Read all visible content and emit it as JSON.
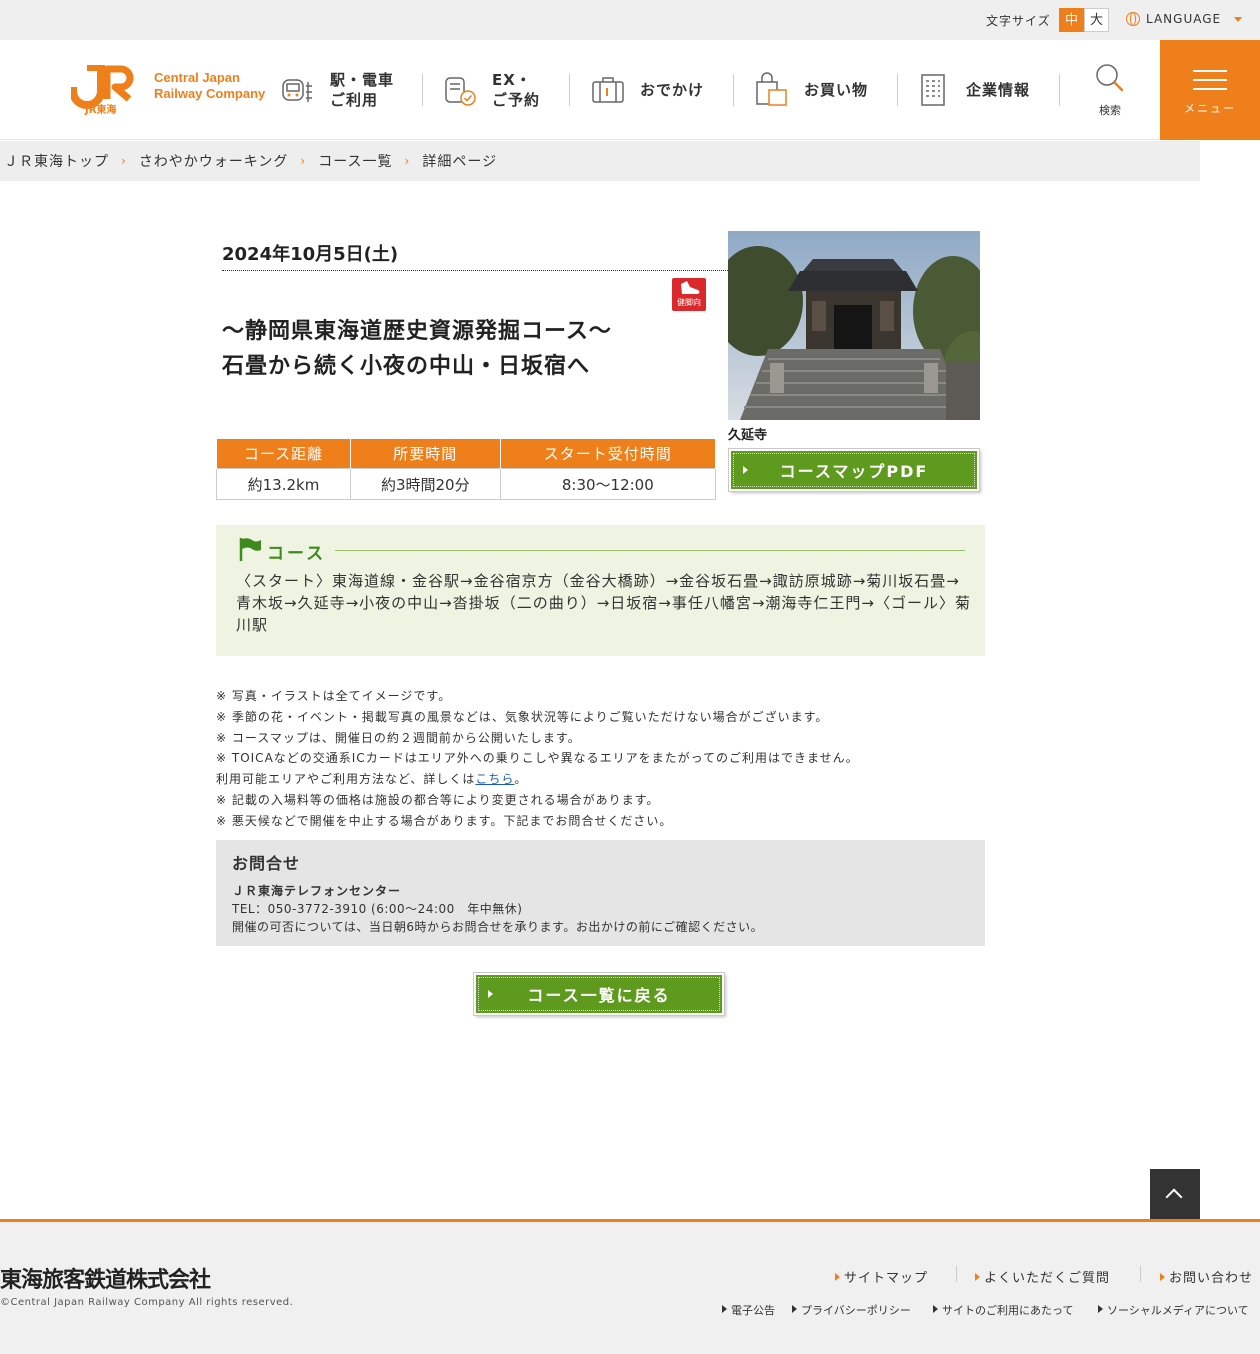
{
  "util": {
    "font_size_label": "文字サイズ",
    "font_mid": "中",
    "font_large": "大",
    "language": "LANGUAGE"
  },
  "header": {
    "logo_mark_text": "JR東海",
    "logo_line1": "Central Japan",
    "logo_line2": "Railway Company",
    "nav": [
      {
        "line1": "駅・電車",
        "line2": "ご利用"
      },
      {
        "line1": "EX・",
        "line2": "ご予約"
      },
      {
        "line1": "おでかけ"
      },
      {
        "line1": "お買い物"
      },
      {
        "line1": "企業情報"
      }
    ],
    "search_label": "検索",
    "menu_label": "メニュー"
  },
  "breadcrumb": [
    "ＪＲ東海トップ",
    "さわやかウォーキング",
    "コース一覧",
    "詳細ページ"
  ],
  "event": {
    "date": "2024年10月5日(土)",
    "badge": "健脚向",
    "title_line1": "〜静岡県東海道歴史資源発掘コース〜",
    "title_line2": "石畳から続く小夜の中山・日坂宿へ",
    "photo_caption": "久延寺",
    "table_headers": [
      "コース距離",
      "所要時間",
      "スタート受付時間"
    ],
    "table_values": [
      "約13.2km",
      "約3時間20分",
      "8:30〜12:00"
    ],
    "pdf_button": "コースマップPDF"
  },
  "course": {
    "heading": "コース",
    "text": "〈スタート〉東海道線・金谷駅→金谷宿京方（金谷大橋跡）→金谷坂石畳→諏訪原城跡→菊川坂石畳→青木坂→久延寺→小夜の中山→沓掛坂（二の曲り）→日坂宿→事任八幡宮→潮海寺仁王門→〈ゴール〉菊川駅"
  },
  "notes": {
    "n1": "※ 写真・イラストは全てイメージです。",
    "n2": "※ 季節の花・イベント・掲載写真の風景などは、気象状況等によりご覧いただけない場合がございます。",
    "n3": "※ コースマップは、開催日の約２週間前から公開いたします。",
    "n4": "※ TOICAなどの交通系ICカードはエリア外への乗りこしや異なるエリアをまたがってのご利用はできません。",
    "n4_sub": "利用可能エリアやご利用方法など、詳しくは",
    "n4_link": "こちら",
    "n4_end": "。",
    "n5": "※ 記載の入場料等の価格は施設の都合等により変更される場合があります。",
    "n6": "※ 悪天候などで開催を中止する場合があります。下記までお問合せください。"
  },
  "contact": {
    "title": "お問合せ",
    "name": "ＪＲ東海テレフォンセンター",
    "tel": "TEL：050-3772-3910 (6:00〜24:00　年中無休)",
    "note": "開催の可否については、当日朝6時からお問合せを承ります。お出かけの前にご確認ください。"
  },
  "back_button": "コース一覧に戻る",
  "footer": {
    "company": "東海旅客鉄道株式会社",
    "copyright": "©Central Japan Railway Company All rights reserved.",
    "links1": [
      "サイトマップ",
      "よくいただくご質問",
      "お問い合わせ"
    ],
    "links2": [
      "電子公告",
      "プライバシーポリシー",
      "サイトのご利用にあたって",
      "ソーシャルメディアについて"
    ]
  },
  "colors": {
    "accent": "#ef7f1a",
    "button_green": "#5e9a1e",
    "course_bg": "#eef4e1"
  }
}
